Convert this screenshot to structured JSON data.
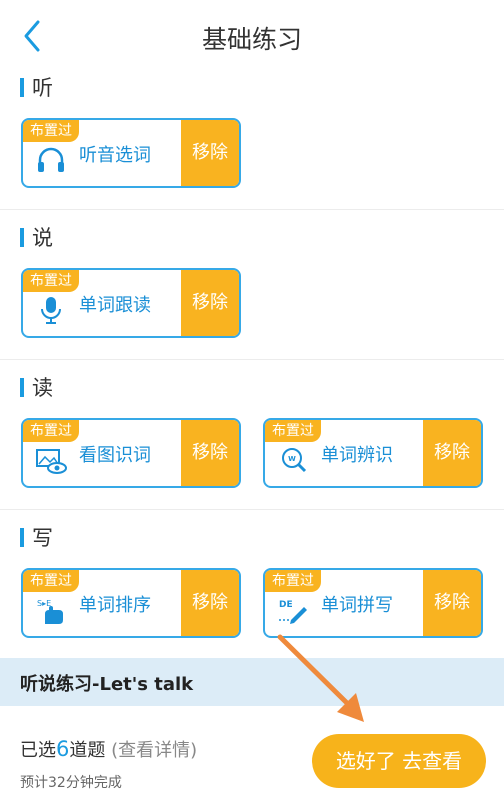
{
  "header": {
    "title": "基础练习",
    "back_icon": "chevron-left-icon"
  },
  "badge_text": "布置过",
  "remove_label": "移除",
  "sections": [
    {
      "title": "听",
      "cards": [
        {
          "label": "听音选词",
          "icon": "headphones-icon"
        }
      ]
    },
    {
      "title": "说",
      "cards": [
        {
          "label": "单词跟读",
          "icon": "microphone-icon"
        }
      ]
    },
    {
      "title": "读",
      "cards": [
        {
          "label": "看图识词",
          "icon": "eye-picture-icon"
        },
        {
          "label": "单词辨识",
          "icon": "word-magnifier-icon"
        }
      ]
    },
    {
      "title": "写",
      "cards": [
        {
          "label": "单词排序",
          "icon": "hand-sort-icon"
        },
        {
          "label": "单词拼写",
          "icon": "pen-spell-icon"
        }
      ]
    }
  ],
  "talk_section": {
    "title": "听说练习-Let's talk"
  },
  "footer": {
    "selected_prefix": "已选",
    "selected_count": "6",
    "selected_suffix": "道题",
    "details_link": "(查看详情)",
    "estimate": "预计32分钟完成",
    "action_button": "选好了 去查看"
  },
  "colors": {
    "accent_blue": "#1a9be0",
    "badge_orange": "#f9b320",
    "button_orange": "#f7b31b",
    "annotation_arrow": "#ef8a3c"
  }
}
